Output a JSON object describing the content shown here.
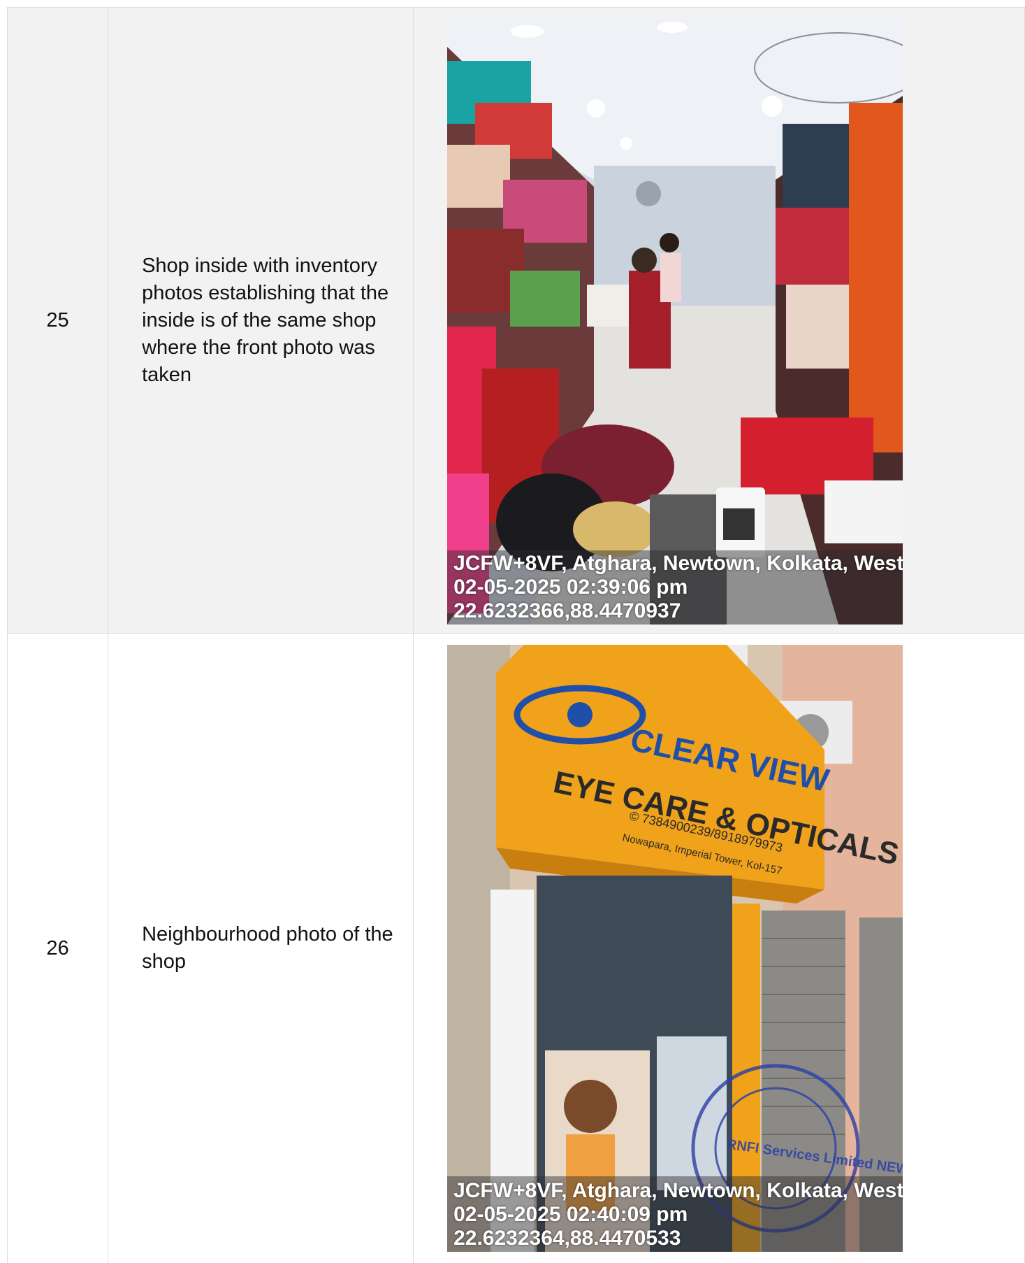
{
  "rows": [
    {
      "number": "25",
      "description": "Shop inside with inventory photos establishing that the inside is of the same shop where the front photo was taken",
      "photo": {
        "icon": "shop-interior-photo",
        "geo_address": "JCFW+8VF, Atghara, Newtown, Kolkata, West",
        "timestamp": "02-05-2025 02:39:06 pm",
        "coordinates": "22.6232366,88.4470937"
      }
    },
    {
      "number": "26",
      "description": "Neighbourhood photo of the shop",
      "photo": {
        "icon": "shop-front-photo",
        "sign_brand": "CLEAR VIEW",
        "sign_title": "EYE CARE & OPTICALS",
        "sign_phone": "© 7384900239/8918979973",
        "sign_address": "Nowapara, Imperial Tower, Kol-157",
        "stamp_text": "RNFI Services Limited NEW DELHI",
        "geo_address": "JCFW+8VF, Atghara, Newtown, Kolkata, West",
        "timestamp": "02-05-2025 02:40:09 pm",
        "coordinates": "22.6232364,88.4470533"
      }
    }
  ],
  "colors": {
    "row_shade": "#f2f2f2",
    "border": "#dcdcdc",
    "sign_orange": "#f0a21a",
    "sign_blue": "#1f4fa8",
    "stamp_blue": "#2b3fa6"
  }
}
